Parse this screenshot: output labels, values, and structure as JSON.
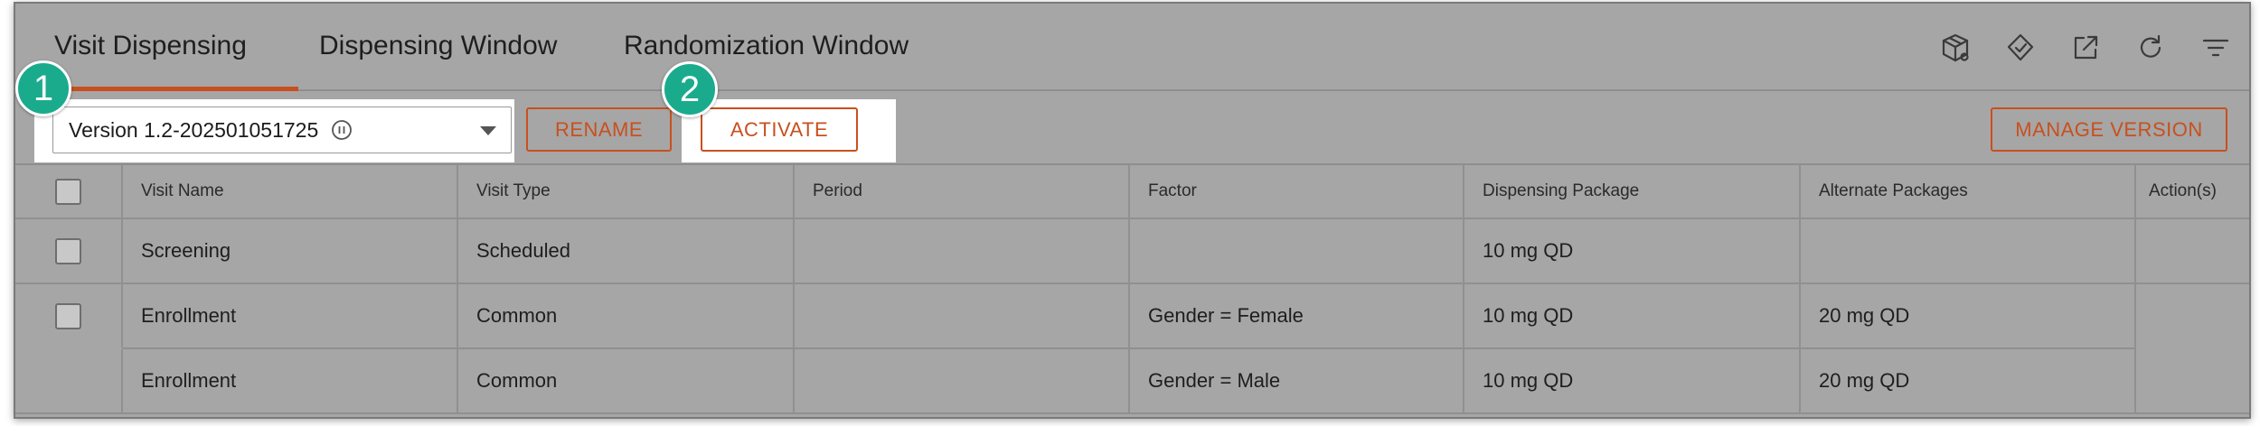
{
  "colors": {
    "accent": "#c8501f",
    "badge": "#1aab8d",
    "overlay": "#a6a6a6"
  },
  "tabs": [
    {
      "label": "Visit Dispensing",
      "active": true
    },
    {
      "label": "Dispensing Window",
      "active": false
    },
    {
      "label": "Randomization Window",
      "active": false
    }
  ],
  "toolbar": {
    "icons": [
      "package-icon",
      "tag-icon",
      "open-external-icon",
      "refresh-icon",
      "filter-icon"
    ]
  },
  "version_select": {
    "value": "Version 1.2-202501051725",
    "status_icon": "pause-icon"
  },
  "buttons": {
    "rename": "RENAME",
    "activate": "ACTIVATE",
    "manage_version": "MANAGE VERSION"
  },
  "badges": [
    "1",
    "2"
  ],
  "table": {
    "columns": [
      "Visit Name",
      "Visit Type",
      "Period",
      "Factor",
      "Dispensing Package",
      "Alternate Packages",
      "Action(s)"
    ],
    "rows": [
      {
        "visit_name": "Screening",
        "visit_type": "Scheduled",
        "period": "",
        "factor": "",
        "dispensing_package": "10 mg QD",
        "alternate_packages": ""
      },
      {
        "visit_name": "Enrollment",
        "visit_type": "Common",
        "period": "",
        "factor": "Gender = Female",
        "dispensing_package": "10 mg QD",
        "alternate_packages": "20 mg QD"
      },
      {
        "visit_name": "Enrollment",
        "visit_type": "Common",
        "period": "",
        "factor": "Gender = Male",
        "dispensing_package": "10 mg QD",
        "alternate_packages": "20 mg QD"
      }
    ]
  }
}
